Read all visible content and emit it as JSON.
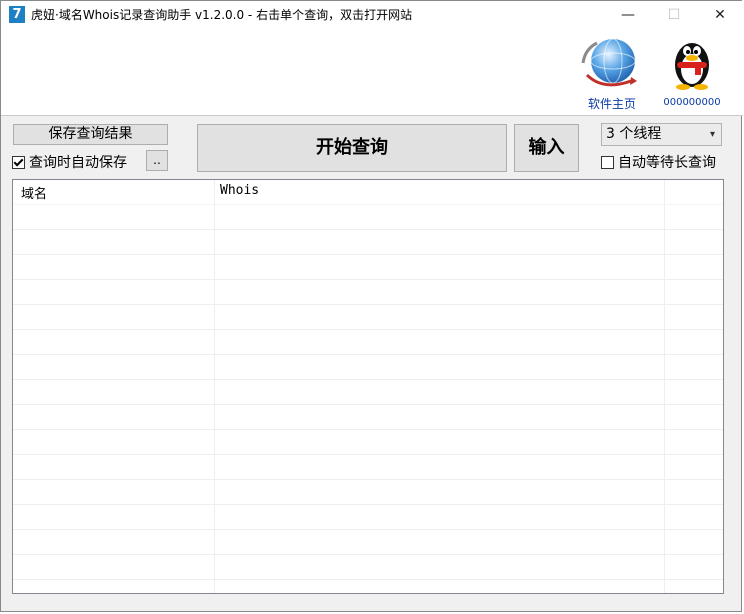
{
  "window": {
    "title": "虎妞·域名Whois记录查询助手 v1.2.0.0 - 右击单个查询，双击打开网站",
    "app_icon_glyph": "7",
    "minimize_glyph": "—",
    "maximize_glyph": "☐",
    "close_glyph": "✕"
  },
  "header": {
    "home_link": "软件主页",
    "qq_number": "000000000",
    "icons": [
      "globe-icon",
      "qq-penguin-icon"
    ]
  },
  "toolbar": {
    "save_results_label": "保存查询结果",
    "auto_save_label": "查询时自动保存",
    "auto_save_checked": true,
    "browse_label": "..",
    "start_label": "开始查询",
    "input_label": "输入",
    "threads_selected": "3 个线程",
    "wait_label": "自动等待长查询",
    "wait_checked": false
  },
  "table": {
    "columns": [
      "域名",
      "Whois"
    ],
    "rows": []
  },
  "colors": {
    "accent": "#1d7fc4",
    "link": "#0a3aa8",
    "background": "#f0f0f0"
  }
}
